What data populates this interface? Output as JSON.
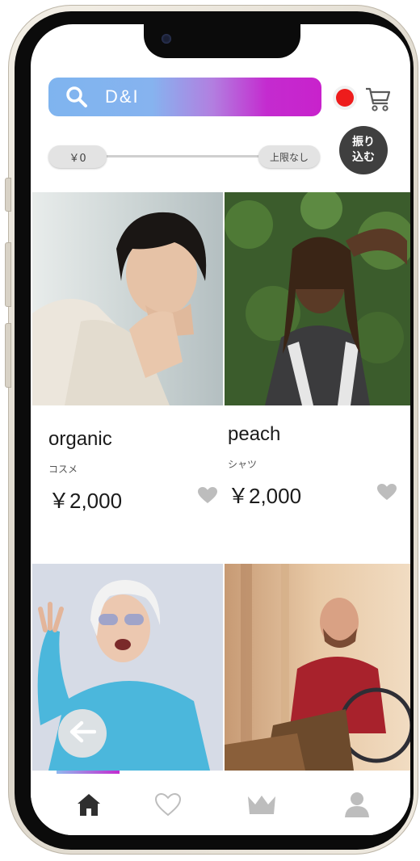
{
  "search": {
    "query": "D&I"
  },
  "filter": {
    "min_label": "￥0",
    "max_label": "上限なし",
    "button_line1": "振り",
    "button_line2": "込む"
  },
  "products": [
    {
      "name": "organic",
      "category": "コスメ",
      "price": "￥2,000"
    },
    {
      "name": "peach",
      "category": "シャツ",
      "price": "￥2,000"
    }
  ],
  "colors": {
    "search_gradient_start": "#7fb4ef",
    "search_gradient_end": "#c822cc",
    "notification": "#ee1c1c",
    "icon_gray": "#bdbdbd",
    "nav_active": "#2f2f2f"
  },
  "icons": {
    "search": "search-icon",
    "cart": "cart-icon",
    "favorite": "heart-icon",
    "back": "arrow-left-icon",
    "nav": [
      "home-icon",
      "heart-outline-icon",
      "crown-icon",
      "user-icon"
    ]
  }
}
